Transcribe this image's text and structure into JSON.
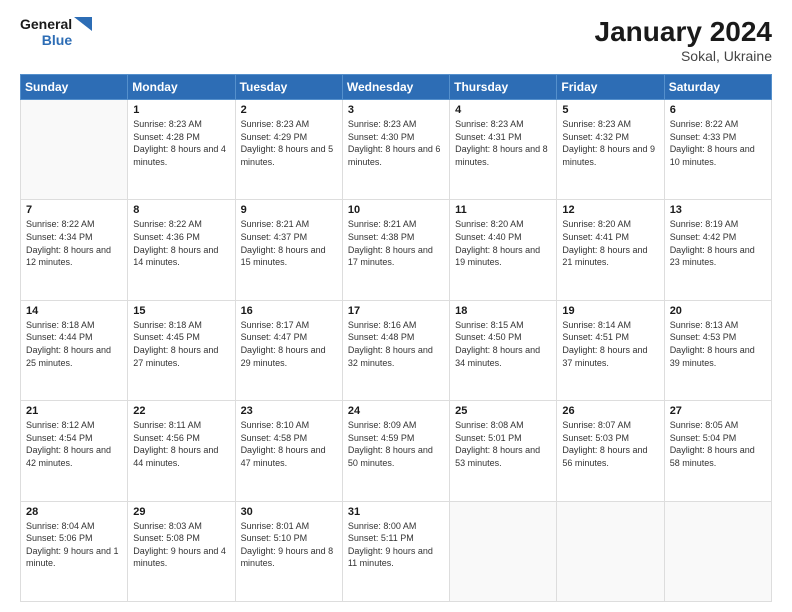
{
  "header": {
    "logo_line1": "General",
    "logo_line2": "Blue",
    "month_year": "January 2024",
    "location": "Sokal, Ukraine"
  },
  "days_of_week": [
    "Sunday",
    "Monday",
    "Tuesday",
    "Wednesday",
    "Thursday",
    "Friday",
    "Saturday"
  ],
  "weeks": [
    [
      {
        "day": "",
        "sunrise": "",
        "sunset": "",
        "daylight": ""
      },
      {
        "day": "1",
        "sunrise": "8:23 AM",
        "sunset": "4:28 PM",
        "daylight": "8 hours and 4 minutes."
      },
      {
        "day": "2",
        "sunrise": "8:23 AM",
        "sunset": "4:29 PM",
        "daylight": "8 hours and 5 minutes."
      },
      {
        "day": "3",
        "sunrise": "8:23 AM",
        "sunset": "4:30 PM",
        "daylight": "8 hours and 6 minutes."
      },
      {
        "day": "4",
        "sunrise": "8:23 AM",
        "sunset": "4:31 PM",
        "daylight": "8 hours and 8 minutes."
      },
      {
        "day": "5",
        "sunrise": "8:23 AM",
        "sunset": "4:32 PM",
        "daylight": "8 hours and 9 minutes."
      },
      {
        "day": "6",
        "sunrise": "8:22 AM",
        "sunset": "4:33 PM",
        "daylight": "8 hours and 10 minutes."
      }
    ],
    [
      {
        "day": "7",
        "sunrise": "8:22 AM",
        "sunset": "4:34 PM",
        "daylight": "8 hours and 12 minutes."
      },
      {
        "day": "8",
        "sunrise": "8:22 AM",
        "sunset": "4:36 PM",
        "daylight": "8 hours and 14 minutes."
      },
      {
        "day": "9",
        "sunrise": "8:21 AM",
        "sunset": "4:37 PM",
        "daylight": "8 hours and 15 minutes."
      },
      {
        "day": "10",
        "sunrise": "8:21 AM",
        "sunset": "4:38 PM",
        "daylight": "8 hours and 17 minutes."
      },
      {
        "day": "11",
        "sunrise": "8:20 AM",
        "sunset": "4:40 PM",
        "daylight": "8 hours and 19 minutes."
      },
      {
        "day": "12",
        "sunrise": "8:20 AM",
        "sunset": "4:41 PM",
        "daylight": "8 hours and 21 minutes."
      },
      {
        "day": "13",
        "sunrise": "8:19 AM",
        "sunset": "4:42 PM",
        "daylight": "8 hours and 23 minutes."
      }
    ],
    [
      {
        "day": "14",
        "sunrise": "8:18 AM",
        "sunset": "4:44 PM",
        "daylight": "8 hours and 25 minutes."
      },
      {
        "day": "15",
        "sunrise": "8:18 AM",
        "sunset": "4:45 PM",
        "daylight": "8 hours and 27 minutes."
      },
      {
        "day": "16",
        "sunrise": "8:17 AM",
        "sunset": "4:47 PM",
        "daylight": "8 hours and 29 minutes."
      },
      {
        "day": "17",
        "sunrise": "8:16 AM",
        "sunset": "4:48 PM",
        "daylight": "8 hours and 32 minutes."
      },
      {
        "day": "18",
        "sunrise": "8:15 AM",
        "sunset": "4:50 PM",
        "daylight": "8 hours and 34 minutes."
      },
      {
        "day": "19",
        "sunrise": "8:14 AM",
        "sunset": "4:51 PM",
        "daylight": "8 hours and 37 minutes."
      },
      {
        "day": "20",
        "sunrise": "8:13 AM",
        "sunset": "4:53 PM",
        "daylight": "8 hours and 39 minutes."
      }
    ],
    [
      {
        "day": "21",
        "sunrise": "8:12 AM",
        "sunset": "4:54 PM",
        "daylight": "8 hours and 42 minutes."
      },
      {
        "day": "22",
        "sunrise": "8:11 AM",
        "sunset": "4:56 PM",
        "daylight": "8 hours and 44 minutes."
      },
      {
        "day": "23",
        "sunrise": "8:10 AM",
        "sunset": "4:58 PM",
        "daylight": "8 hours and 47 minutes."
      },
      {
        "day": "24",
        "sunrise": "8:09 AM",
        "sunset": "4:59 PM",
        "daylight": "8 hours and 50 minutes."
      },
      {
        "day": "25",
        "sunrise": "8:08 AM",
        "sunset": "5:01 PM",
        "daylight": "8 hours and 53 minutes."
      },
      {
        "day": "26",
        "sunrise": "8:07 AM",
        "sunset": "5:03 PM",
        "daylight": "8 hours and 56 minutes."
      },
      {
        "day": "27",
        "sunrise": "8:05 AM",
        "sunset": "5:04 PM",
        "daylight": "8 hours and 58 minutes."
      }
    ],
    [
      {
        "day": "28",
        "sunrise": "8:04 AM",
        "sunset": "5:06 PM",
        "daylight": "9 hours and 1 minute."
      },
      {
        "day": "29",
        "sunrise": "8:03 AM",
        "sunset": "5:08 PM",
        "daylight": "9 hours and 4 minutes."
      },
      {
        "day": "30",
        "sunrise": "8:01 AM",
        "sunset": "5:10 PM",
        "daylight": "9 hours and 8 minutes."
      },
      {
        "day": "31",
        "sunrise": "8:00 AM",
        "sunset": "5:11 PM",
        "daylight": "9 hours and 11 minutes."
      },
      {
        "day": "",
        "sunrise": "",
        "sunset": "",
        "daylight": ""
      },
      {
        "day": "",
        "sunrise": "",
        "sunset": "",
        "daylight": ""
      },
      {
        "day": "",
        "sunrise": "",
        "sunset": "",
        "daylight": ""
      }
    ]
  ]
}
